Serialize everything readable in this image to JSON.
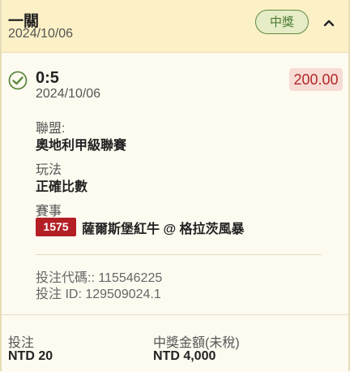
{
  "header": {
    "bet_type": "一關",
    "date": "2024/10/06",
    "status": "中獎",
    "collapse_icon": "chevron-up-icon"
  },
  "bet": {
    "status_icon": "check-circle-icon",
    "score": "0:5",
    "amount": "200.00",
    "date": "2024/10/06",
    "league_label": "聯盟:",
    "league": "奧地利甲級聯賽",
    "play_label": "玩法",
    "play": "正確比數",
    "event_label": "賽事",
    "event_number": "1575",
    "event_name": "薩爾斯堡紅牛 @ 格拉茨風暴",
    "bet_code": "投注代碼:: 115546225",
    "bet_id": "投注 ID: 129509024.1"
  },
  "footer": {
    "stake_label": "投注",
    "stake_value": "NTD 20",
    "payout_label": "中獎金額(未稅)",
    "payout_value": "NTD 4,000"
  },
  "colors": {
    "header_bg": "#fbf0c6",
    "status_green": "#5d8a43",
    "amount_red": "#b2282a",
    "event_badge_red": "#b31f25"
  }
}
